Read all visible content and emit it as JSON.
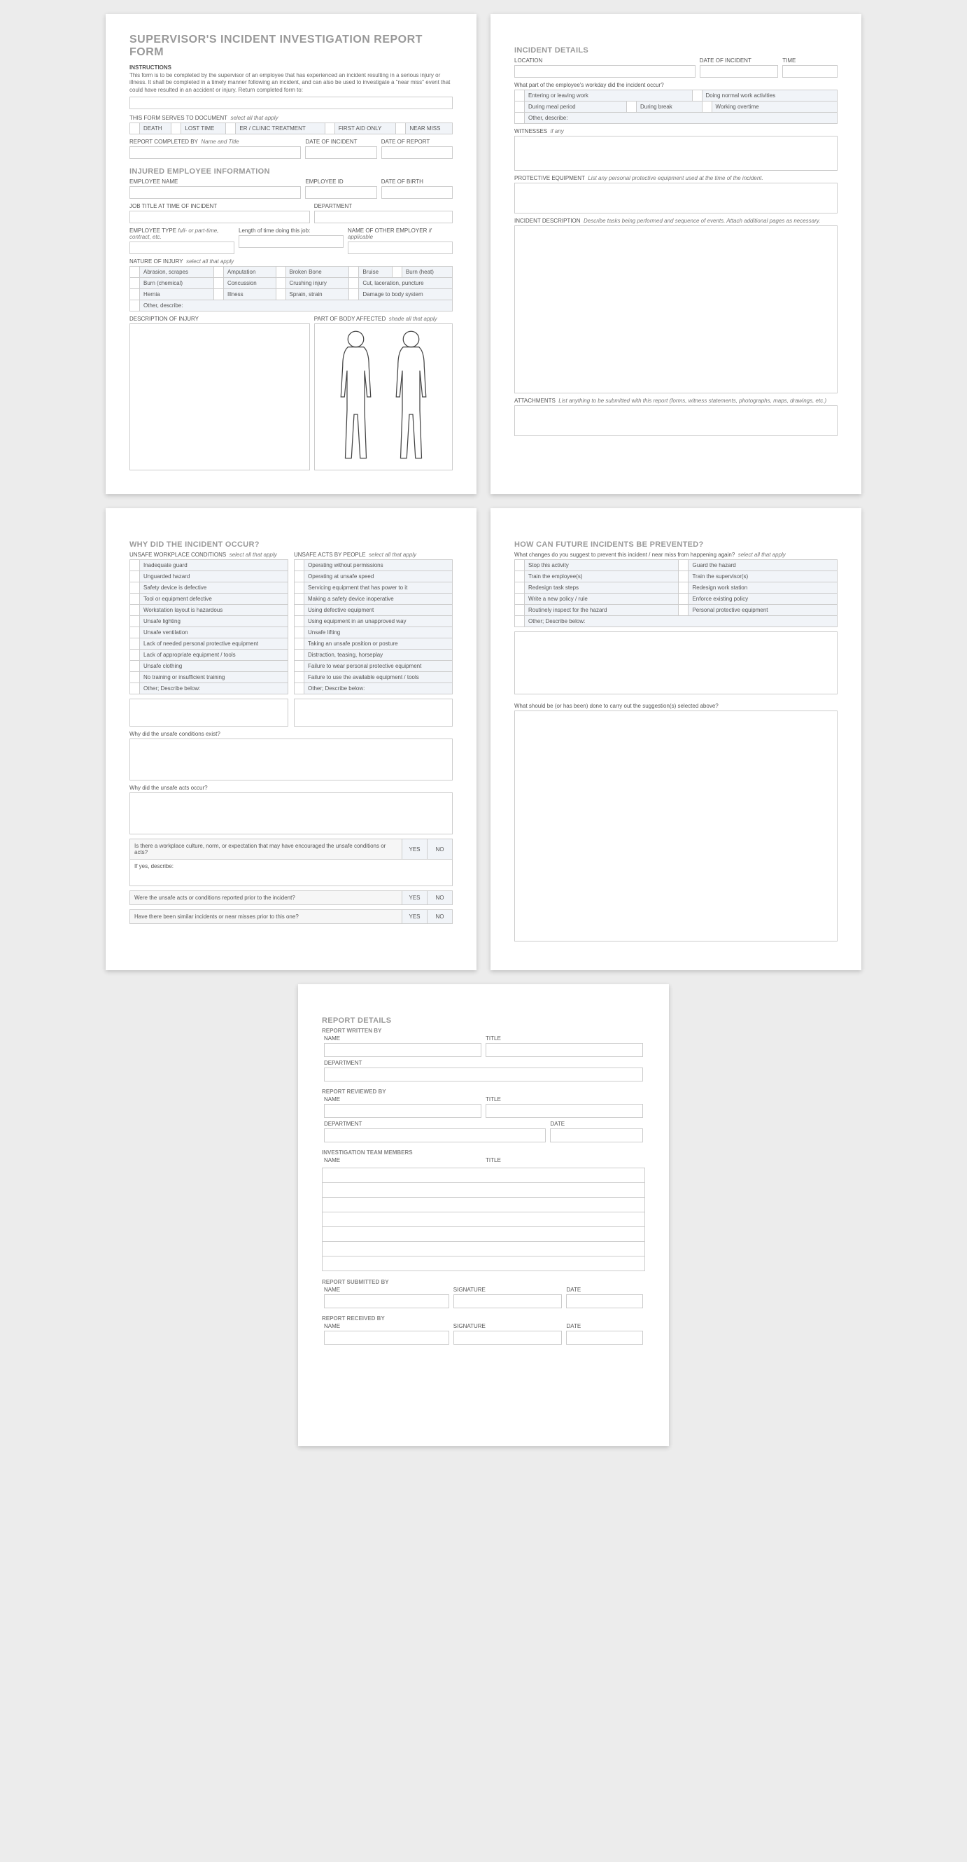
{
  "title": "SUPERVISOR'S INCIDENT INVESTIGATION REPORT FORM",
  "instructions_h": "INSTRUCTIONS",
  "instructions_p": "This form is to be completed by the supervisor of an employee that has experienced an incident resulting in a serious injury or illness. It shall be completed in a timely manner following an incident, and can also be used to investigate a \"near miss\" event that could have resulted in an accident or injury. Return completed form to:",
  "serves_label": "THIS FORM SERVES TO DOCUMENT",
  "select_all": "select all that apply",
  "serve_opts": [
    "DEATH",
    "LOST TIME",
    "ER / CLINIC TREATMENT",
    "FIRST AID ONLY",
    "NEAR MISS"
  ],
  "report_by_l": "REPORT COMPLETED BY",
  "name_title": "Name and Title",
  "date_incident": "DATE OF INCIDENT",
  "date_report": "DATE OF REPORT",
  "inj_emp_h": "INJURED EMPLOYEE INFORMATION",
  "emp_name": "EMPLOYEE NAME",
  "emp_id": "EMPLOYEE ID",
  "dob": "DATE OF BIRTH",
  "job_title": "JOB TITLE AT TIME OF INCIDENT",
  "dept": "DEPARTMENT",
  "emp_type": "EMPLOYEE TYPE",
  "emp_type_hint": "full- or part-time, contract, etc.",
  "len_job": "Length of time doing this job:",
  "other_employer": "NAME OF OTHER EMPLOYER",
  "if_applicable": "if applicable",
  "nature_injury": "NATURE OF INJURY",
  "injury_opts": [
    [
      "Abrasion, scrapes",
      "Amputation",
      "Broken Bone",
      "Bruise",
      "Burn (heat)"
    ],
    [
      "Burn (chemical)",
      "Concussion",
      "Crushing injury",
      "Cut, laceration, puncture",
      ""
    ],
    [
      "Hernia",
      "Illness",
      "Sprain, strain",
      "Damage to body system",
      ""
    ]
  ],
  "other_describe": "Other, describe:",
  "desc_injury": "DESCRIPTION OF INJURY",
  "body_part": "PART OF BODY AFFECTED",
  "shade": "shade all that apply",
  "inc_details_h": "INCIDENT DETAILS",
  "location": "LOCATION",
  "time": "TIME",
  "workday_q": "What part of the employee's workday did the incident occur?",
  "workday_opts": [
    [
      "Entering or leaving work",
      "Doing normal work activities"
    ],
    [
      "During meal period",
      "During break",
      "Working overtime"
    ]
  ],
  "witnesses": "WITNESSES",
  "if_any": "if any",
  "ppe": "PROTECTIVE EQUIPMENT",
  "ppe_hint": "List any personal protective equipment used at the time of the incident.",
  "inc_desc": "INCIDENT DESCRIPTION",
  "inc_desc_hint": "Describe tasks being performed and sequence of events.  Attach additional pages as necessary.",
  "attach": "ATTACHMENTS",
  "attach_hint": "List anything to be submitted with this report (forms, witness statements, photographs, maps, drawings, etc.)",
  "why_h": "WHY DID THE INCIDENT OCCUR?",
  "unsafe_cond_l": "UNSAFE WORKPLACE CONDITIONS",
  "unsafe_acts_l": "UNSAFE ACTS BY PEOPLE",
  "cond_opts": [
    "Inadequate guard",
    "Unguarded hazard",
    "Safety device is defective",
    "Tool or equipment defective",
    "Workstation layout is hazardous",
    "Unsafe lighting",
    "Unsafe ventilation",
    "Lack of needed personal protective equipment",
    "Lack of appropriate equipment / tools",
    "Unsafe clothing",
    "No training or insufficient training",
    "Other; Describe below:"
  ],
  "acts_opts": [
    "Operating without permissions",
    "Operating at unsafe speed",
    "Servicing equipment that has power to it",
    "Making a safety device inoperative",
    "Using defective equipment",
    "Using equipment in an unapproved way",
    "Unsafe lifting",
    "Taking an unsafe position or posture",
    "Distraction, teasing, horseplay",
    "Failure to wear personal protective equipment",
    "Failure to use the available equipment / tools",
    "Other; Describe below:"
  ],
  "why_cond_q": "Why did the unsafe conditions exist?",
  "why_acts_q": "Why did the unsafe acts occur?",
  "culture_q": "Is there a workplace culture, norm, or expectation that may have encouraged the unsafe conditions or acts?",
  "if_yes": "If yes, describe:",
  "reported_q": "Were the unsafe acts or conditions reported prior to the incident?",
  "similar_q": "Have there been similar incidents or near misses prior to this one?",
  "yes": "YES",
  "no": "NO",
  "prevent_h": "HOW CAN FUTURE INCIDENTS BE PREVENTED?",
  "prevent_q": "What changes do you suggest to prevent this incident / near miss from happening again?",
  "prevent_opts": [
    [
      "Stop this activity",
      "Guard the hazard"
    ],
    [
      "Train the employee(s)",
      "Train the supervisor(s)"
    ],
    [
      "Redesign task steps",
      "Redesign work station"
    ],
    [
      "Write a new policy / rule",
      "Enforce existing policy"
    ],
    [
      "Routinely inspect for the hazard",
      "Personal protective equipment"
    ]
  ],
  "prevent_other": "Other; Describe below:",
  "carry_out_q": "What should be (or has been) done to carry out the suggestion(s) selected above?",
  "rd_h": "REPORT DETAILS",
  "rd_written": "REPORT WRITTEN BY",
  "rd_reviewed": "REPORT REVIEWED BY",
  "rd_team": "INVESTIGATION TEAM MEMBERS",
  "rd_submitted": "REPORT SUBMITTED BY",
  "rd_received": "REPORT RECEIVED BY",
  "name_l": "NAME",
  "title_l": "TITLE",
  "dept_l": "DEPARTMENT",
  "date_l": "DATE",
  "sig_l": "SIGNATURE"
}
